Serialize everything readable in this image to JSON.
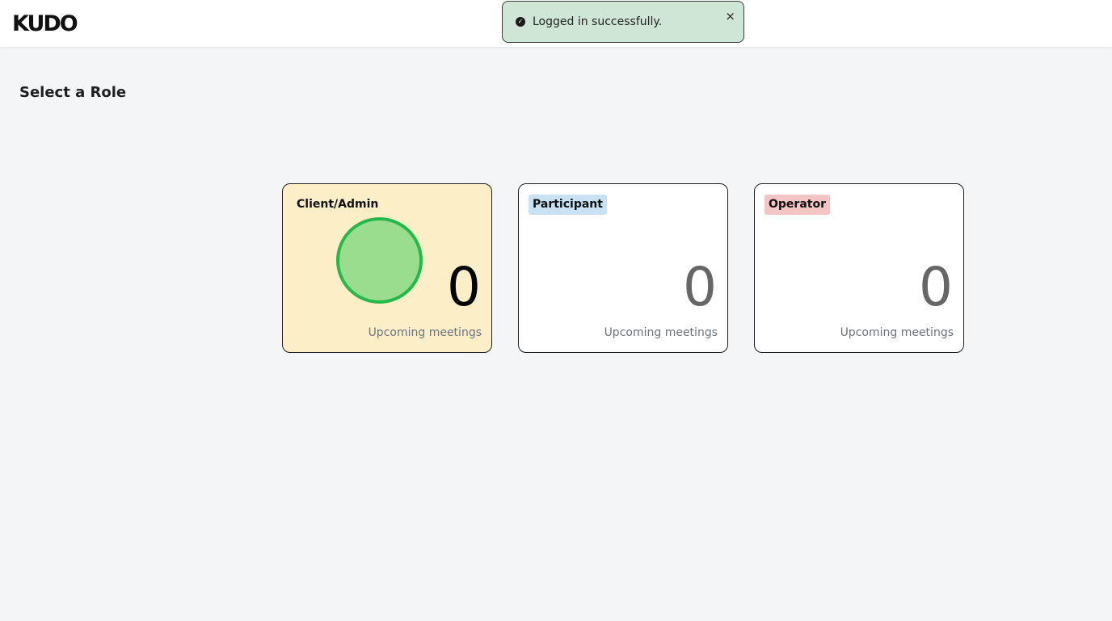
{
  "header": {
    "logo_text": "KUDO"
  },
  "toast": {
    "message": "Logged in successfully.",
    "close_label": "×",
    "icon": "check-circle-icon"
  },
  "page": {
    "title": "Select a Role"
  },
  "roles": [
    {
      "label": "Client/Admin",
      "count": "0",
      "subtitle": "Upcoming meetings",
      "label_bg": "",
      "selected": true
    },
    {
      "label": "Participant",
      "count": "0",
      "subtitle": "Upcoming meetings",
      "label_bg": "#c9e1f5",
      "selected": false
    },
    {
      "label": "Operator",
      "count": "0",
      "subtitle": "Upcoming meetings",
      "label_bg": "#f5c4c4",
      "selected": false
    }
  ],
  "colors": {
    "selected_card_bg": "#fcefc7",
    "toast_bg": "#cfe6d6",
    "page_bg": "#f4f5f7"
  }
}
